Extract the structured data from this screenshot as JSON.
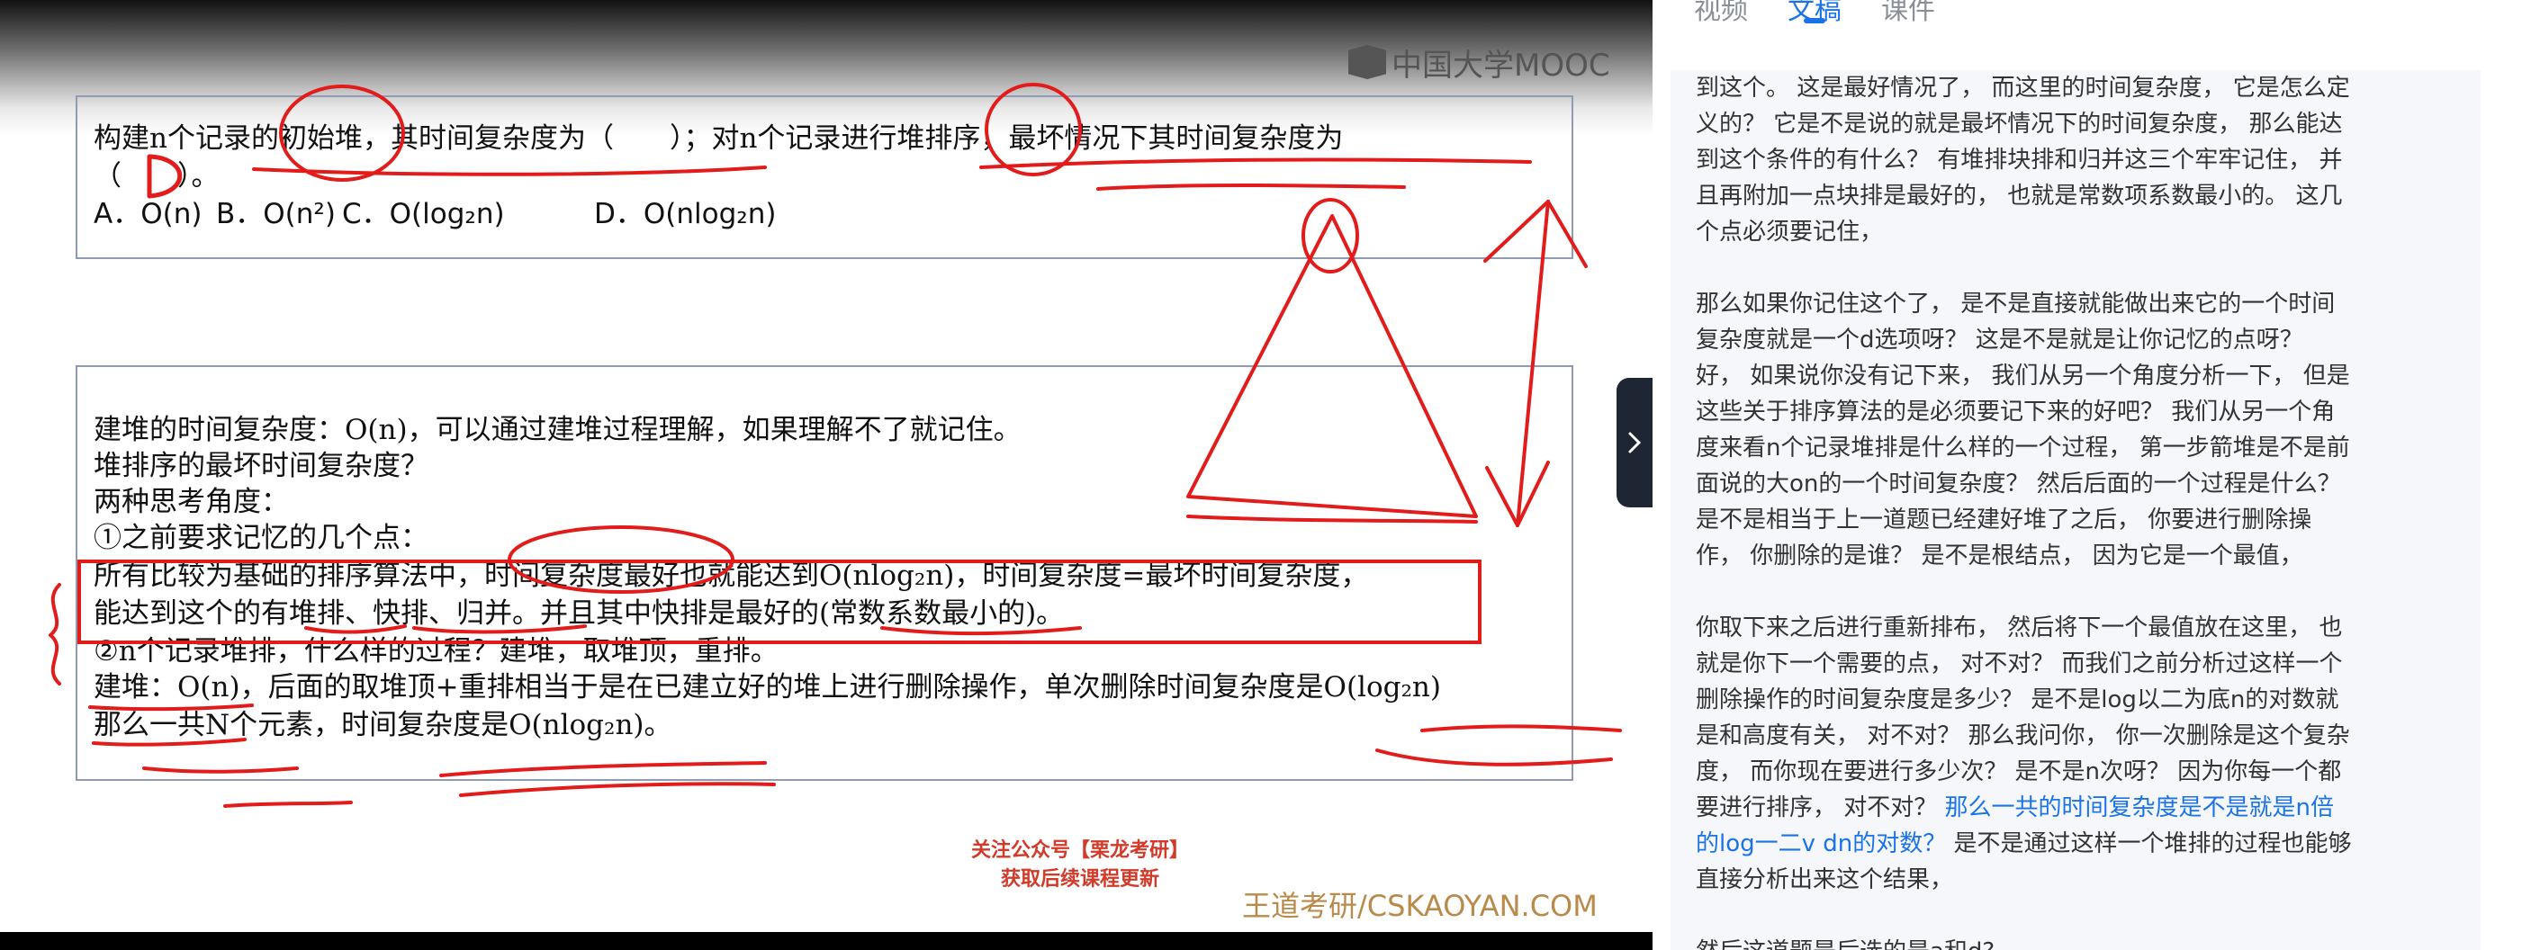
{
  "video": {
    "logo": "中国大学MOOC",
    "question": {
      "line1": "构建n个记录的初始堆，其时间复杂度为（　　）；对n个记录进行堆排序，最坏情况下其时间复杂度为",
      "line2": "（　　）。",
      "options": [
        "A．O(n)",
        "B．O(n²)",
        "C．O(log₂n)",
        "D．O(nlog₂n)"
      ]
    },
    "handwritten_answer": "D",
    "analysis": [
      "建堆的时间复杂度：O(n)，可以通过建堆过程理解，如果理解不了就记住。",
      "堆排序的最坏时间复杂度？",
      "两种思考角度：",
      "①之前要求记忆的几个点：",
      "所有比较为基础的排序算法中，时间复杂度最好也就能达到O(nlog₂n)，时间复杂度=最坏时间复杂度，",
      "能达到这个的有堆排、快排、归并。并且其中快排是最好的(常数系数最小的)。",
      "②n个记录堆排，什么样的过程？建堆，取堆顶，重排。",
      "建堆：O(n)，后面的取堆顶+重排相当于是在已建立好的堆上进行删除操作，单次删除时间复杂度是O(log₂n)",
      "那么一共N个元素，时间复杂度是O(nlog₂n)。"
    ],
    "promo_line1": "关注公众号【栗龙考研】",
    "promo_line2": "获取后续课程更新",
    "watermark": "王道考研/CSKAOYAN.COM",
    "ink_color": "#e21b1b"
  },
  "toggle_icon": "chevron-right-icon",
  "side": {
    "tabs": [
      {
        "label": "视频",
        "active": false
      },
      {
        "label": "文稿",
        "active": true
      },
      {
        "label": "课件",
        "active": false
      }
    ],
    "paragraphs": [
      {
        "lines": [
          "到这个。 这是最好情况了， 而这里的时间复杂度， 它是怎么定",
          "义的？ 它是不是说的就是最坏情况下的时间复杂度， 那么能达",
          "到这个条件的有什么？ 有堆排块排和归并这三个牢牢记住， 并",
          "且再附加一点块排是最好的， 也就是常数项系数最小的。 这几",
          "个点必须要记住，"
        ]
      },
      {
        "lines": [
          "那么如果你记住这个了， 是不是直接就能做出来它的一个时间",
          "复杂度就是一个d选项呀？ 这是不是就是让你记忆的点呀？",
          " 好， 如果说你没有记下来， 我们从另一个角度分析一下， 但是",
          "这些关于排序算法的是必须要记下来的好吧？ 我们从另一个角",
          "度来看n个记录堆排是什么样的一个过程， 第一步箭堆是不是前",
          "面说的大on的一个时间复杂度？ 然后后面的一个过程是什么？",
          " 是不是相当于上一道题已经建好堆了之后， 你要进行删除操",
          "作， 你删除的是谁？ 是不是根结点， 因为它是一个最值，"
        ]
      },
      {
        "lines": [
          "你取下来之后进行重新排布， 然后将下一个最值放在这里， 也",
          "就是你下一个需要的点， 对不对？ 而我们之前分析过这样一个",
          "删除操作的时间复杂度是多少？ 是不是log以二为底n的对数就",
          "是和高度有关， 对不对？ 那么我问你， 你一次删除是这个复杂",
          "度， 而你现在要进行多少次？ 是不是n次呀？ 因为你每一个都",
          "要进行排序， 对不对？ "
        ],
        "highlight": [
          "那么一共的时间复杂度是不是就是n倍",
          "的log一二v dn的对数？"
        ],
        "tail": " 是不是通过这样一个堆排的过程也能够",
        "tail2": "直接分析出来这个结果，"
      },
      {
        "lines": [
          "然后这道题是后选的是a和d?"
        ]
      }
    ],
    "accent_color": "#1a73e8"
  }
}
